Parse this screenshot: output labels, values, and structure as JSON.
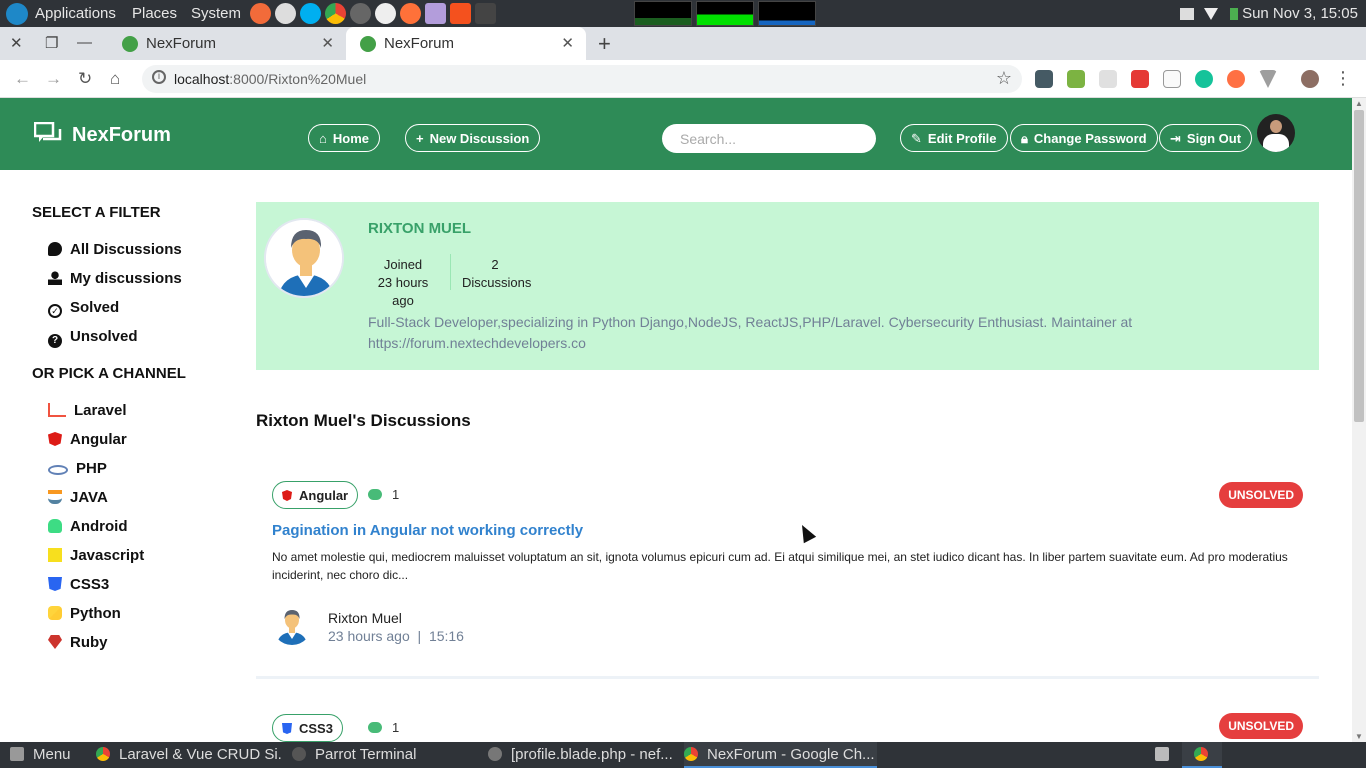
{
  "system_bar": {
    "menus": [
      "Applications",
      "Places",
      "System"
    ],
    "clock": "Sun Nov 3, 15:05",
    "launcher_icons": [
      "browser-icon",
      "paint-icon",
      "skype-icon",
      "chrome-icon",
      "disc-icon",
      "camera-icon",
      "firefox-icon",
      "text-editor-icon",
      "git-icon",
      "terminal-icon"
    ]
  },
  "browser": {
    "tabs": [
      {
        "title": "NexForum",
        "active": false
      },
      {
        "title": "NexForum",
        "active": true
      }
    ],
    "url_host": "localhost",
    "url_rest": ":8000/Rixton%20Muel"
  },
  "header": {
    "brand": "NexForum",
    "home": "Home",
    "new_discussion": "New Discussion",
    "search_placeholder": "Search...",
    "edit_profile": "Edit Profile",
    "change_password": "Change Password",
    "sign_out": "Sign Out"
  },
  "sidebar": {
    "filter_heading": "SELECT A FILTER",
    "filters": [
      {
        "label": "All Discussions",
        "icon": "comments-icon"
      },
      {
        "label": "My discussions",
        "icon": "user-icon"
      },
      {
        "label": "Solved",
        "icon": "check-circle-icon"
      },
      {
        "label": "Unsolved",
        "icon": "question-circle-icon"
      }
    ],
    "channel_heading": "OR PICK A CHANNEL",
    "channels": [
      {
        "label": "Laravel",
        "icon": "laravel-icon",
        "color": "#f05340"
      },
      {
        "label": "Angular",
        "icon": "angular-icon",
        "color": "#dd1b16"
      },
      {
        "label": "PHP",
        "icon": "php-icon",
        "color": "#6181b6"
      },
      {
        "label": "JAVA",
        "icon": "java-icon",
        "color": "#5382a1"
      },
      {
        "label": "Android",
        "icon": "android-icon",
        "color": "#3ddc84"
      },
      {
        "label": "Javascript",
        "icon": "javascript-icon",
        "color": "#f7df1e"
      },
      {
        "label": "CSS3",
        "icon": "css3-icon",
        "color": "#2965f1"
      },
      {
        "label": "Python",
        "icon": "python-icon",
        "color": "#ffd43b"
      },
      {
        "label": "Ruby",
        "icon": "ruby-icon",
        "color": "#cc342d"
      }
    ]
  },
  "profile": {
    "name": "RIXTON MUEL",
    "joined_label": "Joined",
    "joined_value": "23 hours ago",
    "discussions_count": "2",
    "discussions_label": "Discussions",
    "bio": "Full-Stack Developer,specializing in Python Django,NodeJS, ReactJS,PHP/Laravel. Cybersecurity Enthusiast. Maintainer at https://forum.nextechdevelopers.co"
  },
  "discussions_title": "Rixton Muel's Discussions",
  "discussions": [
    {
      "channel": "Angular",
      "channel_color": "#dd1b16",
      "replies": "1",
      "status": "UNSOLVED",
      "title": "Pagination in Angular not working correctly",
      "excerpt": "No amet molestie qui, mediocrem maluisset voluptatum an sit, ignota volumus epicuri cum ad. Ei atqui similique mei, an stet iudico dicant has. In liber partem suavitate eum. Ad pro moderatius inciderint, nec choro dic...",
      "author": "Rixton Muel",
      "time_ago": "23 hours ago",
      "time": "15:16"
    },
    {
      "channel": "CSS3",
      "channel_color": "#2965f1",
      "replies": "1",
      "status": "UNSOLVED"
    }
  ],
  "taskbar": {
    "menu": "Menu",
    "items": [
      {
        "label": "Laravel & Vue CRUD Si...",
        "icon": "chrome-icon"
      },
      {
        "label": "Parrot Terminal",
        "icon": "terminal-icon"
      },
      {
        "label": "[profile.blade.php - nef...",
        "icon": "editor-icon"
      },
      {
        "label": "NexForum - Google Ch...",
        "icon": "chrome-icon",
        "active": true
      }
    ]
  }
}
